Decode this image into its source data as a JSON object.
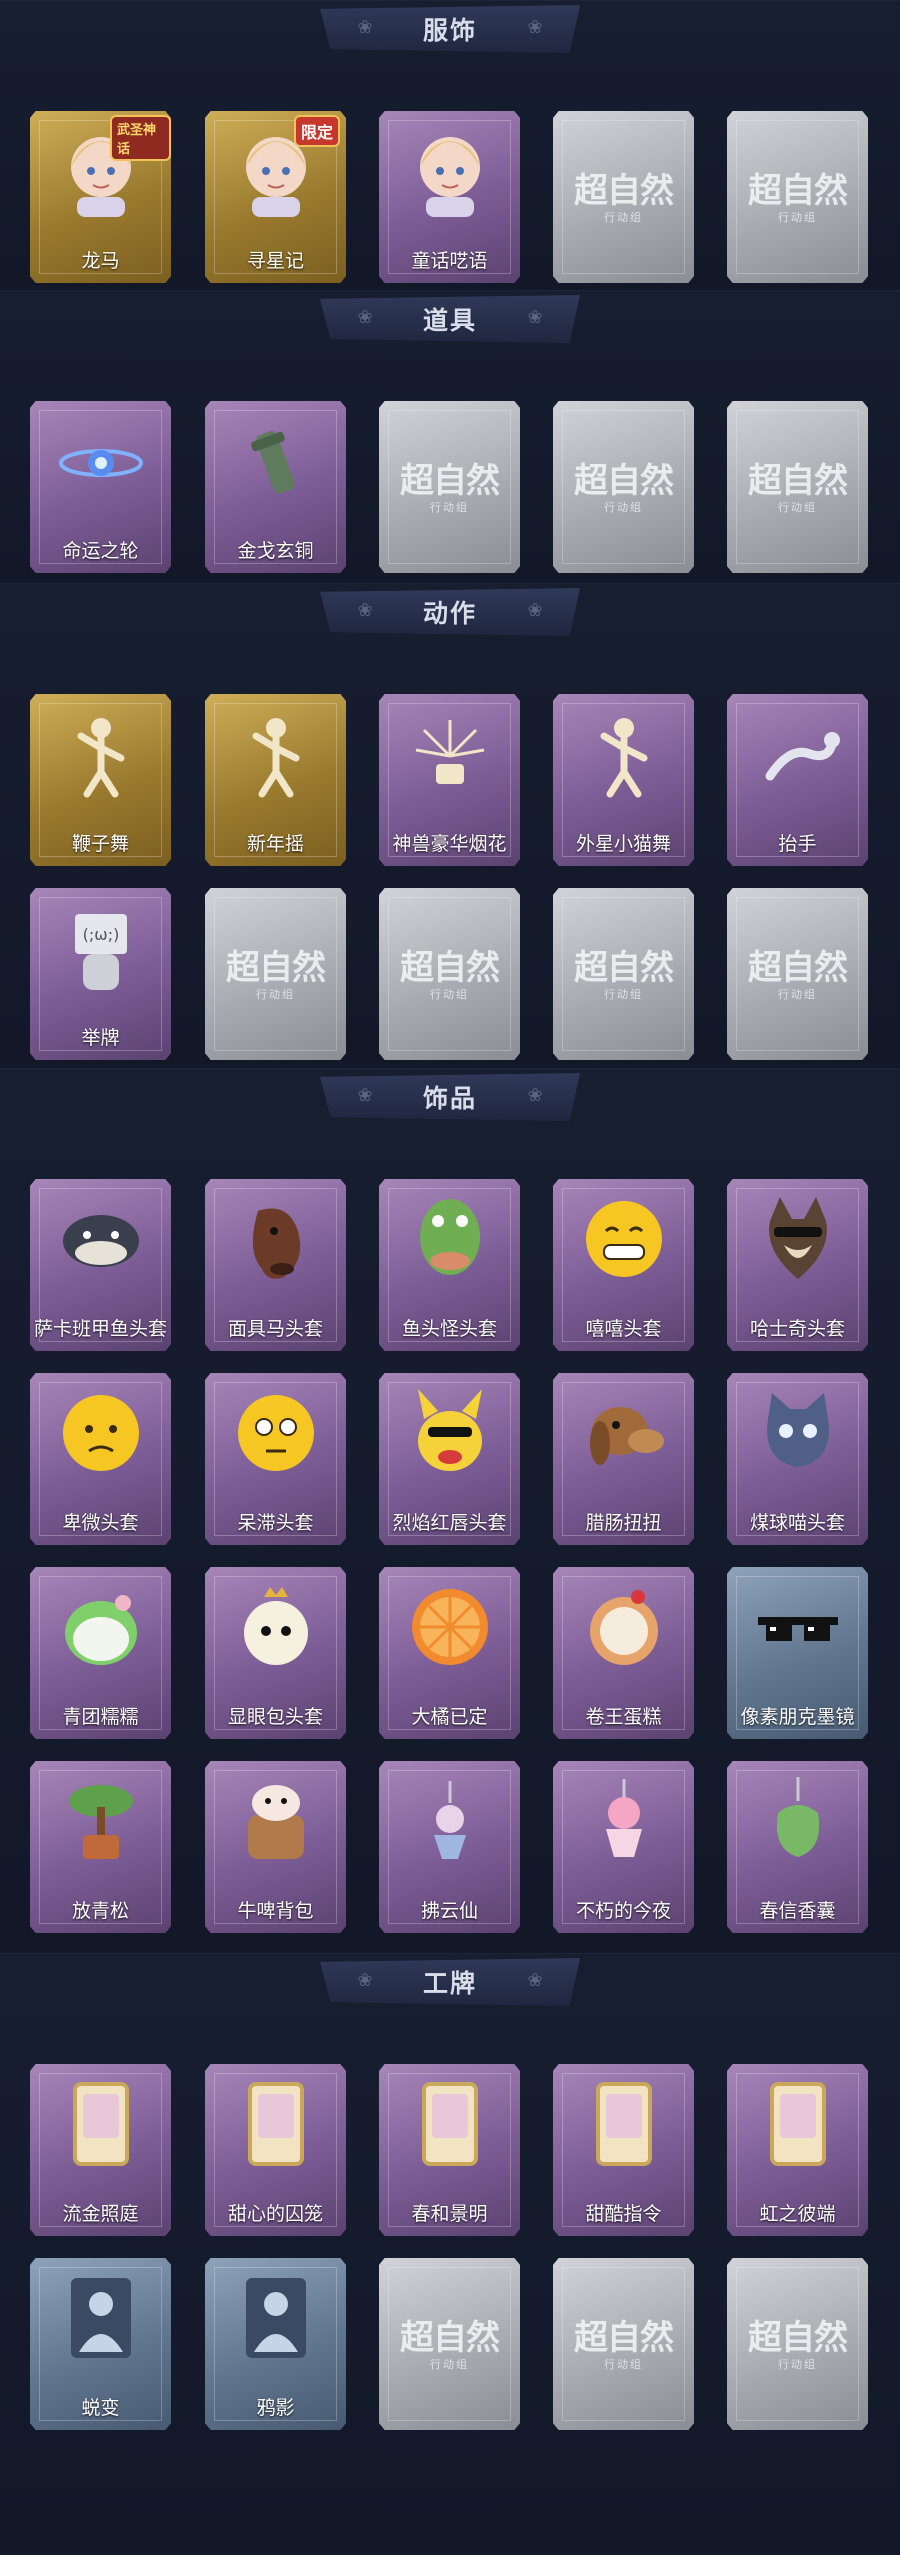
{
  "watermark": {
    "text": "超自然",
    "sub": "行动组"
  },
  "sections": [
    {
      "title": "服饰",
      "cards": [
        {
          "label": "龙马",
          "tier": "gold",
          "icon": "character-portrait-icon",
          "badge": "武圣神话"
        },
        {
          "label": "寻星记",
          "tier": "gold",
          "icon": "character-portrait-icon",
          "badge": "限定"
        },
        {
          "label": "童话呓语",
          "tier": "purple",
          "icon": "character-portrait-icon"
        },
        {
          "label": "",
          "tier": "gray",
          "icon": "watermark-placeholder"
        },
        {
          "label": "",
          "tier": "gray",
          "icon": "watermark-placeholder"
        }
      ]
    },
    {
      "title": "道具",
      "cards": [
        {
          "label": "命运之轮",
          "tier": "purple",
          "icon": "wheel-orb-icon"
        },
        {
          "label": "金戈玄铜",
          "tier": "purple",
          "icon": "bronze-relic-icon"
        },
        {
          "label": "",
          "tier": "gray",
          "icon": "watermark-placeholder"
        },
        {
          "label": "",
          "tier": "gray",
          "icon": "watermark-placeholder"
        },
        {
          "label": "",
          "tier": "gray",
          "icon": "watermark-placeholder"
        }
      ]
    },
    {
      "title": "动作",
      "cards": [
        {
          "label": "鞭子舞",
          "tier": "gold",
          "icon": "dance-pose-icon"
        },
        {
          "label": "新年摇",
          "tier": "gold",
          "icon": "dance-pose-icon"
        },
        {
          "label": "神兽豪华烟花",
          "tier": "purple",
          "icon": "firework-icon"
        },
        {
          "label": "外星小猫舞",
          "tier": "purple",
          "icon": "dance-pose-icon"
        },
        {
          "label": "抬手",
          "tier": "purple",
          "icon": "hand-raise-icon"
        },
        {
          "label": "举牌",
          "tier": "purple",
          "icon": "sign-hold-icon"
        },
        {
          "label": "",
          "tier": "gray",
          "icon": "watermark-placeholder"
        },
        {
          "label": "",
          "tier": "gray",
          "icon": "watermark-placeholder"
        },
        {
          "label": "",
          "tier": "gray",
          "icon": "watermark-placeholder"
        },
        {
          "label": "",
          "tier": "gray",
          "icon": "watermark-placeholder"
        }
      ]
    },
    {
      "title": "饰品",
      "cards": [
        {
          "label": "萨卡班甲鱼头套",
          "tier": "purple",
          "icon": "fish-head-icon"
        },
        {
          "label": "面具马头套",
          "tier": "purple",
          "icon": "horse-head-icon"
        },
        {
          "label": "鱼头怪头套",
          "tier": "purple",
          "icon": "fish-monster-icon"
        },
        {
          "label": "嘻嘻头套",
          "tier": "purple",
          "icon": "grin-face-icon"
        },
        {
          "label": "哈士奇头套",
          "tier": "purple",
          "icon": "husky-head-icon"
        },
        {
          "label": "卑微头套",
          "tier": "purple",
          "icon": "sad-face-icon"
        },
        {
          "label": "呆滞头套",
          "tier": "purple",
          "icon": "blank-face-icon"
        },
        {
          "label": "烈焰红唇头套",
          "tier": "purple",
          "icon": "pikachu-head-icon"
        },
        {
          "label": "腊肠扭扭",
          "tier": "purple",
          "icon": "dachshund-head-icon"
        },
        {
          "label": "煤球喵头套",
          "tier": "purple",
          "icon": "cat-head-icon"
        },
        {
          "label": "青团糯糯",
          "tier": "purple",
          "icon": "green-dumpling-icon"
        },
        {
          "label": "显眼包头套",
          "tier": "purple",
          "icon": "bun-head-icon"
        },
        {
          "label": "大橘已定",
          "tier": "purple",
          "icon": "orange-slice-icon"
        },
        {
          "label": "卷王蛋糕",
          "tier": "purple",
          "icon": "roll-cake-icon"
        },
        {
          "label": "像素朋克墨镜",
          "tier": "blue",
          "icon": "pixel-sunglasses-icon"
        },
        {
          "label": "放青松",
          "tier": "purple",
          "icon": "bonsai-pine-icon"
        },
        {
          "label": "牛啤背包",
          "tier": "purple",
          "icon": "cow-backpack-icon"
        },
        {
          "label": "拂云仙",
          "tier": "purple",
          "icon": "fairy-charm-icon"
        },
        {
          "label": "不朽的今夜",
          "tier": "purple",
          "icon": "dessert-cup-icon"
        },
        {
          "label": "春信香囊",
          "tier": "purple",
          "icon": "sachet-icon"
        }
      ]
    },
    {
      "title": "工牌",
      "cards": [
        {
          "label": "流金照庭",
          "tier": "purple",
          "icon": "badge-frame-icon"
        },
        {
          "label": "甜心的囚笼",
          "tier": "purple",
          "icon": "badge-frame-icon"
        },
        {
          "label": "春和景明",
          "tier": "purple",
          "icon": "badge-frame-icon"
        },
        {
          "label": "甜酷指令",
          "tier": "purple",
          "icon": "badge-frame-icon"
        },
        {
          "label": "虹之彼端",
          "tier": "purple",
          "icon": "badge-frame-icon"
        },
        {
          "label": "蜕变",
          "tier": "blue",
          "icon": "silhouette-icon"
        },
        {
          "label": "鸦影",
          "tier": "blue",
          "icon": "silhouette-icon"
        },
        {
          "label": "",
          "tier": "gray",
          "icon": "watermark-placeholder"
        },
        {
          "label": "",
          "tier": "gray",
          "icon": "watermark-placeholder"
        },
        {
          "label": "",
          "tier": "gray",
          "icon": "watermark-placeholder"
        }
      ]
    }
  ]
}
